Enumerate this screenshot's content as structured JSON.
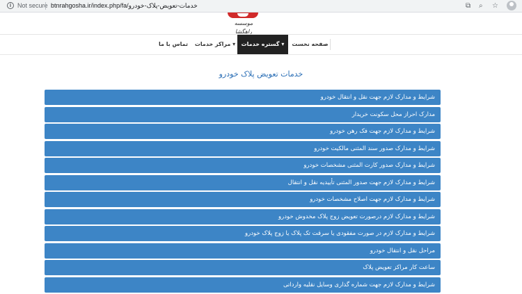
{
  "browser": {
    "security_label": "Not secure",
    "url": "btnrahgosha.ir/index.php/fa/خدمات-تعویض-پلاک-خودرو"
  },
  "header": {
    "logo_text": "موسسه راهگشا"
  },
  "nav": {
    "items": [
      {
        "label": "صفحه نخست"
      },
      {
        "label": "گستره خدمات ▾"
      },
      {
        "label": "مراکز خدمات ▾"
      },
      {
        "label": "تماس با ما"
      }
    ]
  },
  "main": {
    "title": "خدمات تعویض پلاک خودرو",
    "items": [
      "شرایط و مدارک لازم جهت نقل و انتقال خودرو",
      "مدارک احراز محل سکونت خریدار",
      "شرایط و مدارک لازم جهت فک رهن خودرو",
      "شرایط و مدارک صدور سند المثنی مالکیت خودرو",
      "شرایط و مدارک صدور کارت المثنی مشخصات خودرو",
      "شرایط و مدارک لازم جهت صدور المثنی تأییدیه نقل و انتقال",
      "شرایط و مدارک لازم جهت اصلاح مشخصات خودرو",
      "شرایط و مدارک لازم درصورت تعویض زوج پلاک مخدوش خودرو",
      "شرایط و مدارک لازم در صورت مفقودی یا سرقت تک پلاک یا زوج پلاک خودرو",
      "مراحل نقل و انتقال خودرو",
      "ساعت کار مراکز تعویض پلاک",
      "شرایط و مدارک لازم جهت شماره گذاری وسایل نقلیه وارداتی"
    ]
  },
  "colors": {
    "item_bg": "#3d85c6",
    "title": "#2a6eb5",
    "nav_active": "#222222"
  }
}
